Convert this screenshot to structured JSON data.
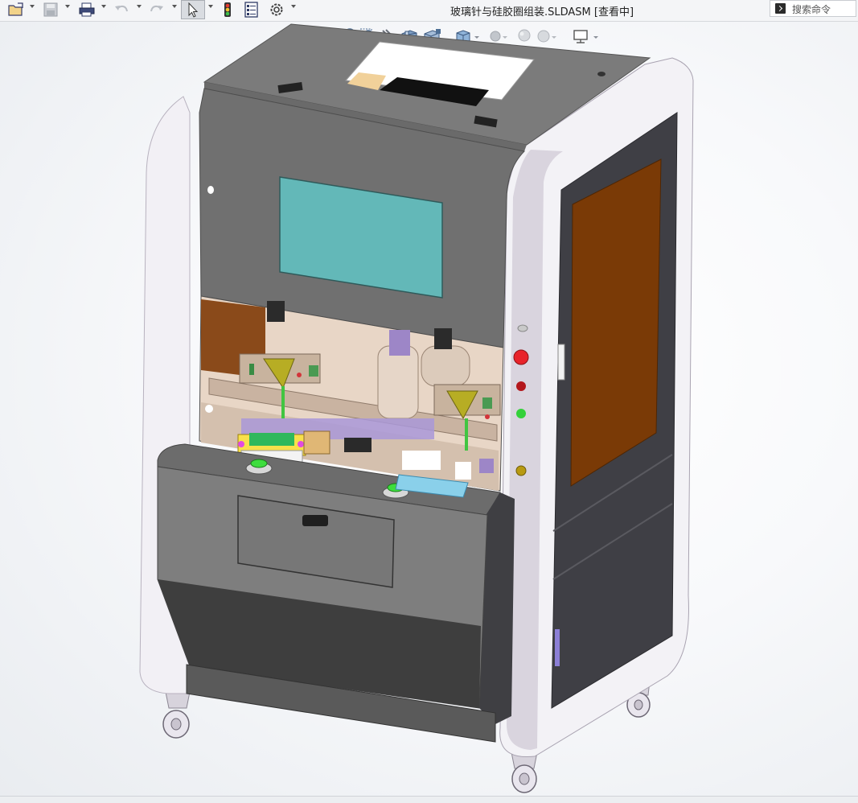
{
  "window": {
    "title": "玻璃针与硅胶圈组装.SLDASM [查看中]"
  },
  "search": {
    "placeholder": "搜索命令"
  },
  "toolbar": {
    "items": [
      "open-icon",
      "save-icon",
      "print-icon",
      "undo-icon",
      "redo-icon",
      "select-icon",
      "traffic-light-icon",
      "file-properties-icon",
      "options-icon"
    ]
  },
  "view_toolbar": {
    "items": [
      "zoom-to-fit-icon",
      "zoom-area-icon",
      "previous-view-icon",
      "section-view-icon",
      "dynamic-annotation-icon",
      "view-orientation-icon",
      "display-style-icon",
      "hide-show-icon",
      "appearance-icon",
      "scene-icon",
      "display-settings-icon"
    ]
  },
  "model": {
    "name": "glass-needle-silicone-ring-assembly",
    "colors": {
      "frame_white": "#f3f2f6",
      "frame_purple_tint": "#c8bfd0",
      "body_gray": "#7a7a7a",
      "dark_gray": "#3e3e3e",
      "screen": "#63b8b8",
      "door_window": "#7a3a06",
      "inner_wall": "#8a4a1a"
    }
  }
}
